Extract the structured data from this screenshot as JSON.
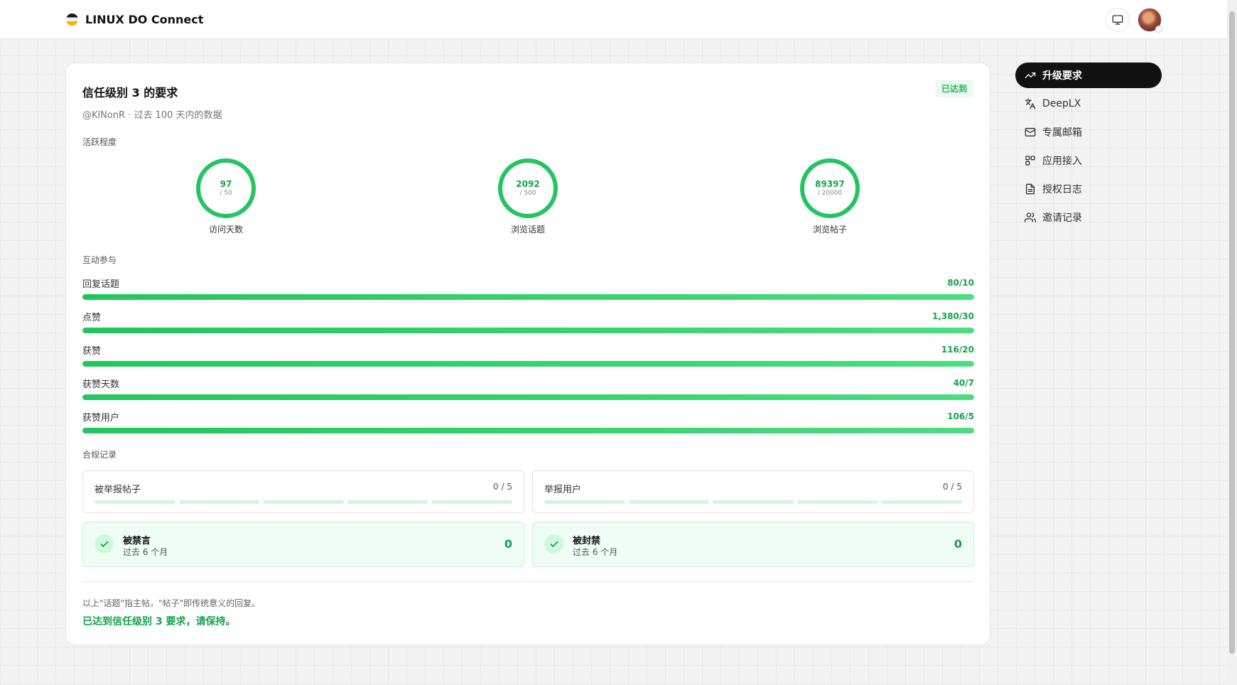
{
  "header": {
    "brand": "LINUX DO Connect",
    "monitor_icon": "monitor-icon",
    "avatar_icon": "user-avatar"
  },
  "card": {
    "title": "信任级别 3 的要求",
    "badge": "已达到",
    "subtitle": "@KlNonR · 过去 100 天内的数据",
    "activity_label": "活跃程度",
    "rings": [
      {
        "value": "97",
        "target": "/ 50",
        "label": "访问天数"
      },
      {
        "value": "2092",
        "target": "/ 500",
        "label": "浏览话题"
      },
      {
        "value": "89397",
        "target": "/ 20000",
        "label": "浏览帖子"
      }
    ],
    "interaction_label": "互动参与",
    "bars": [
      {
        "name": "回复话题",
        "value": "80/10",
        "progress": 1.0
      },
      {
        "name": "点赞",
        "value": "1,380/30",
        "progress": 1.0
      },
      {
        "name": "获赞",
        "value": "116/20",
        "progress": 1.0
      },
      {
        "name": "获赞天数",
        "value": "40/7",
        "progress": 1.0
      },
      {
        "name": "获赞用户",
        "value": "106/5",
        "progress": 1.0
      }
    ],
    "compliance_label": "合规记录",
    "flags": [
      {
        "title": "被举报帖子",
        "count": "0 / 5"
      },
      {
        "title": "举报用户",
        "count": "0 / 5"
      }
    ],
    "penalties": [
      {
        "title": "被禁言",
        "sub": "过去 6 个月",
        "count": "0"
      },
      {
        "title": "被封禁",
        "sub": "过去 6 个月",
        "count": "0"
      }
    ],
    "note": "以上\"话题\"指主帖，\"帖子\"即传统意义的回复。",
    "status": "已达到信任级别 3 要求，请保持。"
  },
  "nav": {
    "items": [
      {
        "label": "升级要求",
        "icon": "trending-up-icon",
        "active": true
      },
      {
        "label": "DeepLX",
        "icon": "translate-icon",
        "active": false
      },
      {
        "label": "专属邮箱",
        "icon": "mail-icon",
        "active": false
      },
      {
        "label": "应用接入",
        "icon": "apps-icon",
        "active": false
      },
      {
        "label": "授权日志",
        "icon": "document-icon",
        "active": false
      },
      {
        "label": "邀请记录",
        "icon": "users-icon",
        "active": false
      }
    ]
  },
  "colors": {
    "accent_green": "#22c55e",
    "nav_active": "#111111"
  }
}
